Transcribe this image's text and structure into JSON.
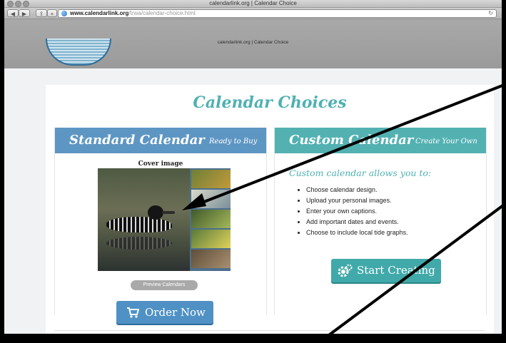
{
  "browser": {
    "window_title": "calendarlink.org | Calendar Choice",
    "url_host": "www.calendarlink.org",
    "url_path": "/trwa/calendar-choice.html",
    "tab_title": "calendarlink.org | Calendar Choice",
    "back_icon": "◀",
    "forward_icon": "▶",
    "share_icon": "⇪",
    "add_icon": "+",
    "reload_icon": "↻"
  },
  "page": {
    "heading": "Calendar Choices",
    "standard": {
      "title": "Standard Calendar",
      "subtitle": "Ready to Buy",
      "cover_label": "Cover image",
      "preview_button": "Preview Calendars",
      "order_button": "Order Now"
    },
    "custom": {
      "title": "Custom Calendar",
      "subtitle": "Create Your Own",
      "tagline": "Custom calendar allows you to:",
      "features": [
        "Choose calendar design.",
        "Upload your personal images.",
        "Enter your own captions.",
        "Add important dates and events.",
        "Choose to include local tide graphs."
      ],
      "start_button": "Start Creating"
    }
  },
  "colors": {
    "standard_header": "#5e96c3",
    "custom_header": "#53b1b2",
    "heading": "#4fb1b3"
  }
}
